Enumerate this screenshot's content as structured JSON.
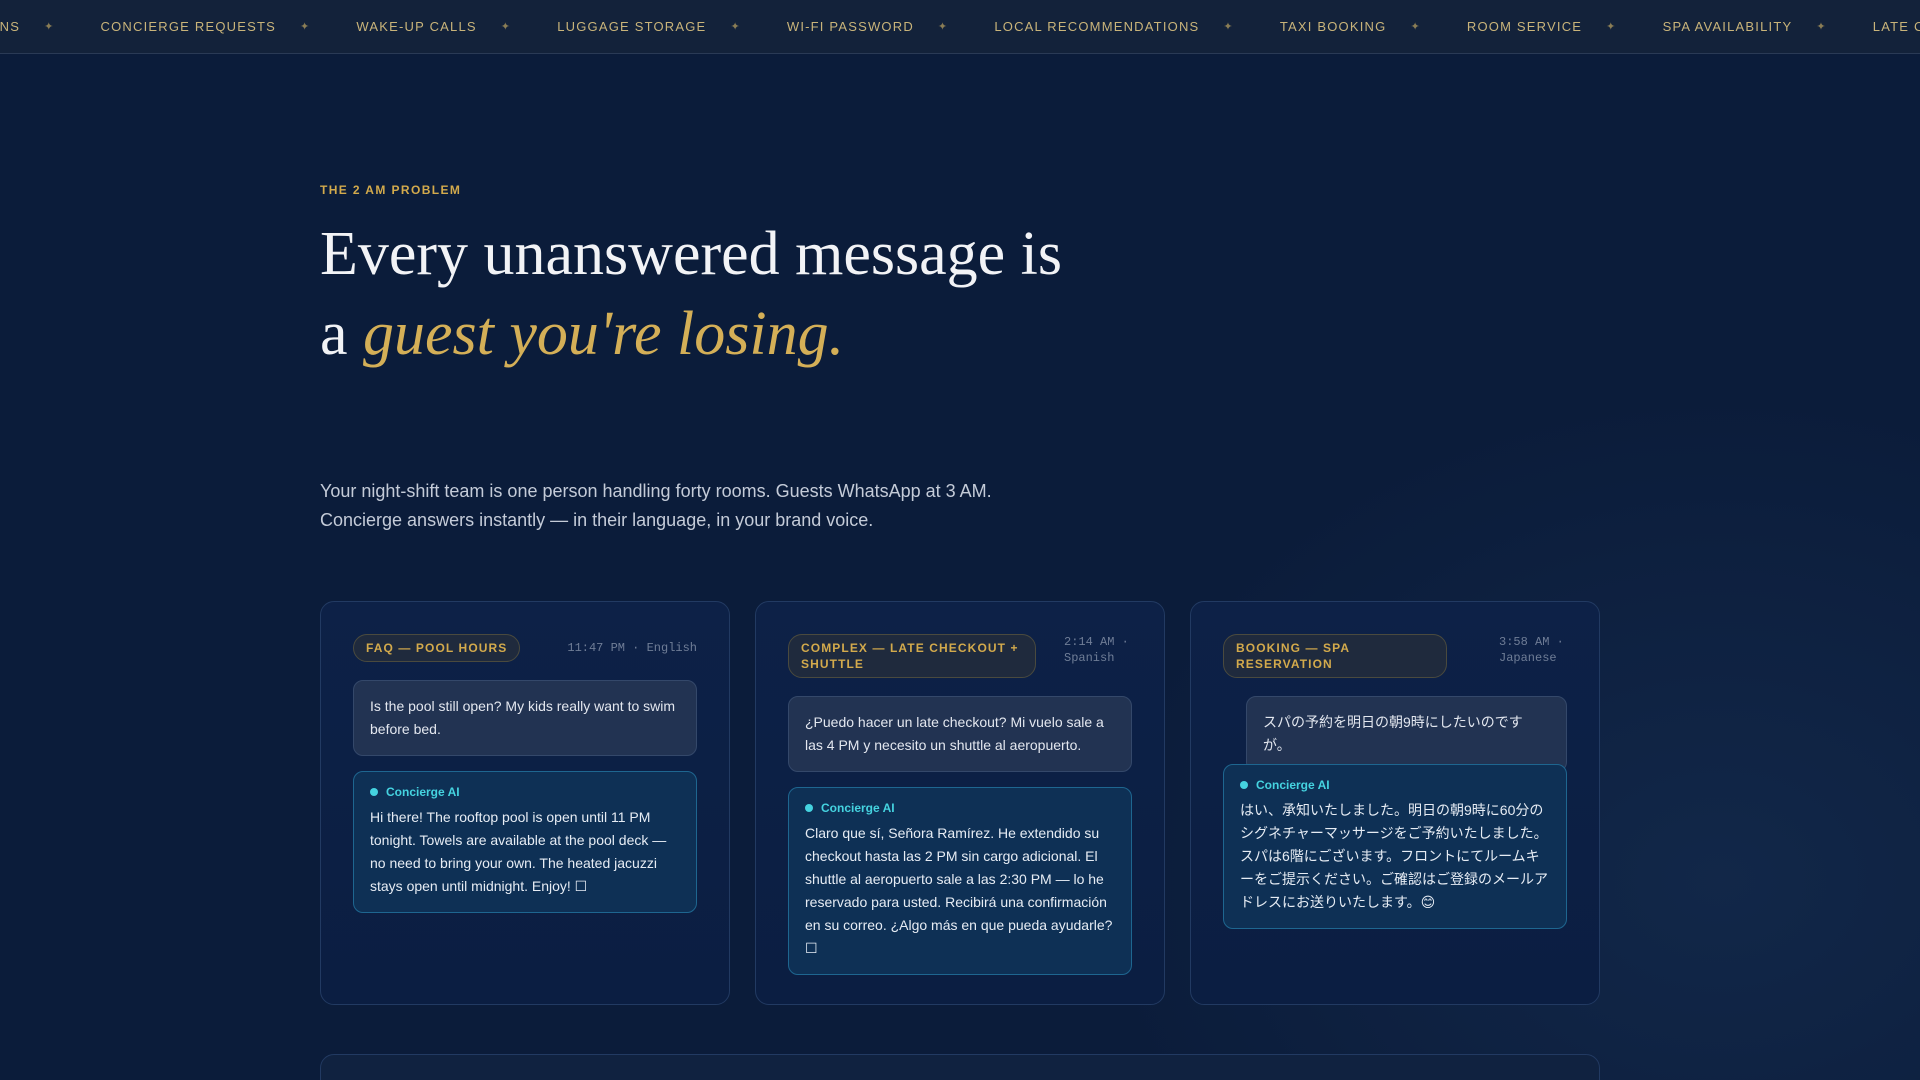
{
  "ticker": {
    "items": [
      "Reservations",
      "Concierge Requests",
      "Wake-up Calls",
      "Luggage Storage",
      "Wi-Fi Password",
      "Local Recommendations",
      "Taxi Booking",
      "Room Service",
      "Spa Availability",
      "Late Checkout"
    ],
    "separator_icon": "sparkle-icon"
  },
  "hero": {
    "eyebrow": "The 2 AM Problem",
    "headline_plain": "Every unanswered message is a ",
    "headline_accent": "guest you're losing.",
    "lede": "Your night-shift team is one person handling forty rooms. Guests WhatsApp at 3 AM. Concierge answers instantly — in their language, in your brand voice."
  },
  "cards": [
    {
      "tag": "FAQ — Pool Hours",
      "meta": "11:47 PM · English",
      "guest_message": "Is the pool still open? My kids really want to swim before bed.",
      "ai_label": "Concierge AI",
      "ai_message": "Hi there! The rooftop pool is open until 11 PM tonight. Towels are available at the pool deck — no need to bring your own. The heated jacuzzi stays open until midnight. Enjoy! ☐"
    },
    {
      "tag": "Complex — Late Checkout + Shuttle",
      "meta": "2:14 AM · Spanish",
      "guest_message": "¿Puedo hacer un late checkout? Mi vuelo sale a las 4 PM y necesito un shuttle al aeropuerto.",
      "ai_label": "Concierge AI",
      "ai_message": "Claro que sí, Señora Ramírez. He extendido su checkout hasta las 2 PM sin cargo adicional. El shuttle al aeropuerto sale a las 2:30 PM — lo he reservado para usted. Recibirá una confirmación en su correo. ¿Algo más en que pueda ayudarle? ☐"
    },
    {
      "tag": "Booking — Spa Reservation",
      "meta": "3:58 AM · Japanese",
      "guest_message": "スパの予約を明日の朝9時にしたいのですが。",
      "ai_label": "Concierge AI",
      "ai_message": "はい、承知いたしました。明日の朝9時に60分のシグネチャーマッサージをご予約いたしました。スパは6階にございます。フロントにてルームキーをご提示ください。ご確認はご登録のメールアドレスにお送りいたします。😊"
    }
  ],
  "colors": {
    "background": "#0b1c3a",
    "gold_accent": "#d4af57",
    "ai_cyan": "#45d3e0"
  }
}
